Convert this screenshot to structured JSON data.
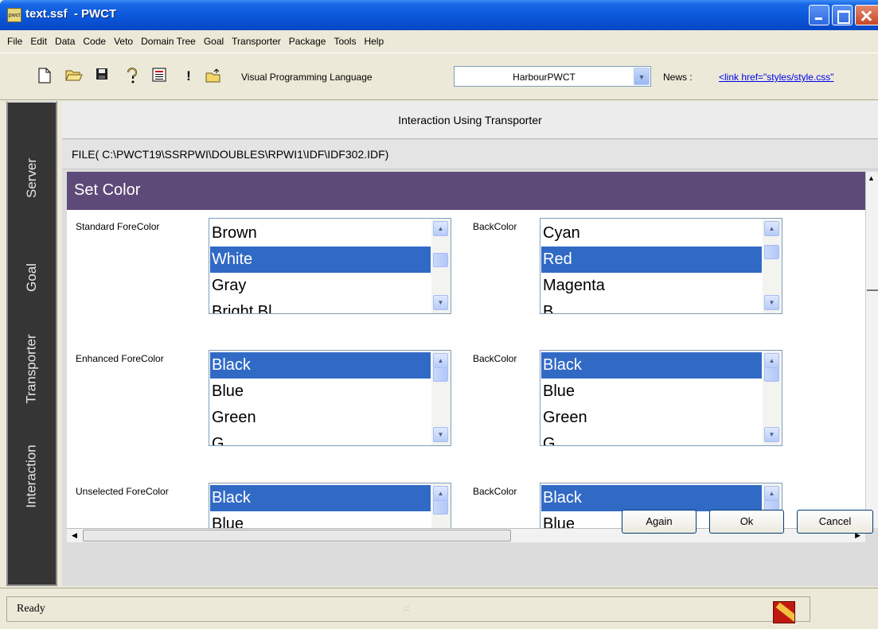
{
  "window": {
    "title": "text.ssf  - PWCT",
    "icon_text": "pwct"
  },
  "menu": [
    "File",
    "Edit",
    "Data",
    "Code",
    "Veto",
    "Domain Tree",
    "Goal",
    "Transporter",
    "Package",
    "Tools",
    "Help"
  ],
  "toolbar": {
    "icons": [
      "new-document-icon",
      "open-folder-icon",
      "save-icon",
      "help-icon",
      "document-icon",
      "exclamation-icon",
      "folder-up-icon"
    ],
    "vpl_label": "Visual Programming Language",
    "vpl_selected": "HarbourPWCT",
    "news_label": "News :",
    "news_link": "<link href=\"styles/style.css\""
  },
  "sidebar": {
    "tabs": [
      "Server",
      "Goal",
      "Transporter",
      "Interaction"
    ]
  },
  "panel": {
    "header": "Interaction Using Transporter",
    "file_line": "FILE( C:\\PWCT19\\SSRPWI\\DOUBLES\\RPWI1\\IDF\\IDF302.IDF)",
    "form_title": "Set Color",
    "rows": [
      {
        "fore_label": "Standard ForeColor",
        "fore_items": [
          "Brown",
          "White",
          "Gray",
          "Bright Bl"
        ],
        "fore_selected": 1,
        "back_label": "BackColor",
        "back_items": [
          "Cyan",
          "Red",
          "Magenta",
          "B"
        ],
        "back_selected": 1
      },
      {
        "fore_label": "Enhanced ForeColor",
        "fore_items": [
          "Black",
          "Blue",
          "Green",
          "G"
        ],
        "fore_selected": 0,
        "back_label": "BackColor",
        "back_items": [
          "Black",
          "Blue",
          "Green",
          "G"
        ],
        "back_selected": 0
      },
      {
        "fore_label": "Unselected ForeColor",
        "fore_items": [
          "Black",
          "Blue"
        ],
        "fore_selected": 0,
        "back_label": "BackColor",
        "back_items": [
          "Black",
          "Blue"
        ],
        "back_selected": 0
      }
    ],
    "buttons": {
      "again": "Again",
      "ok": "Ok",
      "cancel": "Cancel"
    }
  },
  "status": {
    "text": "Ready",
    "grip": ".::"
  },
  "colors": {
    "title_bar": "#0a55d8",
    "form_header": "#5e4a78",
    "selection": "#316ac5",
    "sidebar": "#353535"
  }
}
